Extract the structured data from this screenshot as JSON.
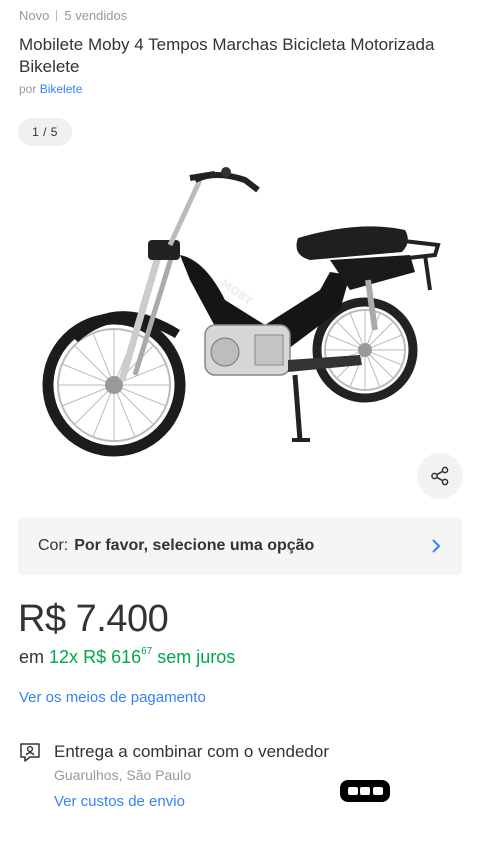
{
  "header": {
    "condition": "Novo",
    "sold": "5 vendidos",
    "title": "Mobilete Moby 4 Tempos Marchas Bicicleta Motorizada Bikelete",
    "seller_prefix": "por",
    "seller_name": "Bikelete"
  },
  "gallery": {
    "counter": "1 / 5",
    "image": "black moped with silver engine and spoked wheels"
  },
  "variant": {
    "label": "Cor:",
    "value": "Por favor, selecione uma opção"
  },
  "pricing": {
    "price": "R$ 7.400",
    "installment_prefix": "em",
    "installment_count": "12x",
    "installment_value": "R$ 616",
    "installment_cents": "67",
    "installment_suffix": "sem juros",
    "payment_link": "Ver os meios de pagamento"
  },
  "shipping": {
    "title": "Entrega a combinar com o vendedor",
    "location": "Guarulhos, São Paulo",
    "link": "Ver custos de envio"
  },
  "colors": {
    "link": "#3483fa",
    "green": "#00a650",
    "text": "#333333",
    "muted": "#999999"
  },
  "icons": {
    "share": "share-icon",
    "chevron": "chevron-right-icon",
    "shipping": "chat-person-icon"
  }
}
